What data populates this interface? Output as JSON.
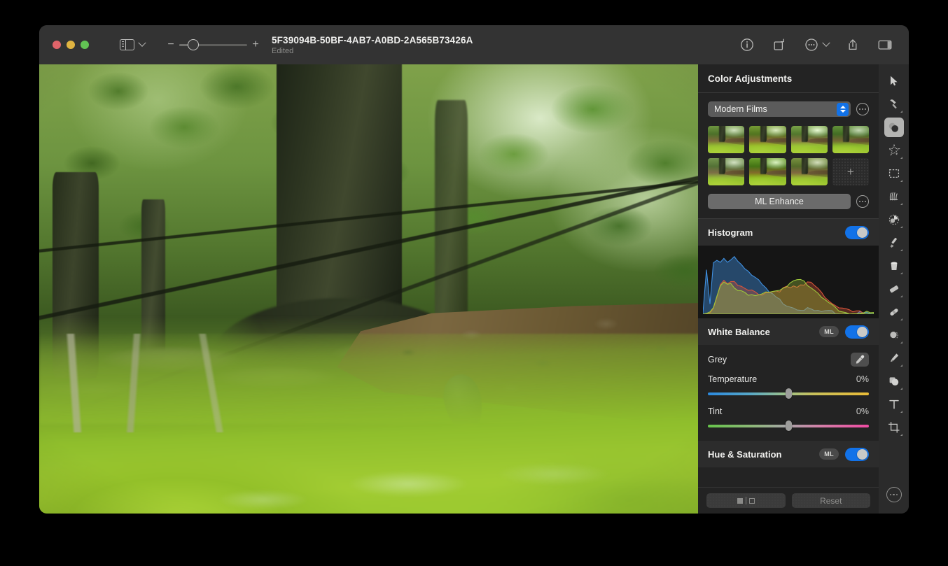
{
  "window": {
    "title": "5F39094B-50BF-4AB7-A0BD-2A565B73426A",
    "subtitle": "Edited",
    "traffic_lights": [
      "close-button",
      "minimize-button",
      "maximize-button"
    ]
  },
  "toolbar": {
    "sidebar_icon": "sidebar-icon",
    "sidebar_chevron": "chevron-down-icon",
    "zoom_out": "−",
    "zoom_in": "+",
    "zoom_value": 20,
    "right_icons": [
      "info-icon",
      "rotate-icon",
      "more-options-icon",
      "share-icon",
      "right-panel-icon"
    ]
  },
  "panel": {
    "title": "Color Adjustments",
    "presets": {
      "selected": "Modern Films",
      "options": [
        "Modern Films"
      ],
      "thumbnail_count": 7,
      "add_label": "+"
    },
    "ml_enhance": {
      "label": "ML Enhance"
    },
    "histogram": {
      "label": "Histogram",
      "enabled": true
    },
    "white_balance": {
      "label": "White Balance",
      "ml_badge": "ML",
      "enabled": true,
      "grey": {
        "label": "Grey",
        "icon": "eyedropper-icon"
      },
      "temperature": {
        "label": "Temperature",
        "value": "0%",
        "position": 50
      },
      "tint": {
        "label": "Tint",
        "value": "0%",
        "position": 50
      }
    },
    "hue_saturation": {
      "label": "Hue & Saturation",
      "ml_badge": "ML",
      "enabled": true
    },
    "footer": {
      "compare_label": "",
      "reset_label": "Reset"
    }
  },
  "tools": [
    {
      "name": "select-arrow-tool",
      "icon": "cursor-arrow-icon",
      "selected": false
    },
    {
      "name": "repair-tool",
      "icon": "hammer-icon",
      "selected": false
    },
    {
      "name": "color-adjustments-tool",
      "icon": "color-circles-icon",
      "selected": true
    },
    {
      "name": "magic-wand-tool",
      "icon": "star-sparkle-icon",
      "selected": false
    },
    {
      "name": "marquee-tool",
      "icon": "dashed-rectangle-icon",
      "selected": false
    },
    {
      "name": "retouch-tool",
      "icon": "brush-fan-icon",
      "selected": false
    },
    {
      "name": "dodge-burn-tool",
      "icon": "dodge-circle-icon",
      "selected": false
    },
    {
      "name": "paintbrush-tool",
      "icon": "paintbrush-icon",
      "selected": false
    },
    {
      "name": "paint-bucket-tool",
      "icon": "paint-bucket-icon",
      "selected": false
    },
    {
      "name": "eraser-tool",
      "icon": "eraser-icon",
      "selected": false
    },
    {
      "name": "heal-tool",
      "icon": "bandage-icon",
      "selected": false
    },
    {
      "name": "blur-tool",
      "icon": "blur-circle-icon",
      "selected": false
    },
    {
      "name": "pen-tool",
      "icon": "fountain-pen-icon",
      "selected": false
    },
    {
      "name": "shapes-tool",
      "icon": "shapes-icon",
      "selected": false
    },
    {
      "name": "text-tool",
      "icon": "text-t-icon",
      "selected": false
    },
    {
      "name": "crop-tool",
      "icon": "crop-icon",
      "selected": false
    }
  ],
  "tools_more": "more-tools-icon",
  "colors": {
    "accent_blue": "#1272e8",
    "window_bg": "#2b2b2b",
    "titlebar_bg": "#333333",
    "panel_bg": "#232323",
    "histogram_bg": "#151515",
    "close_red": "#e0646a",
    "min_yellow": "#e0b441",
    "max_green": "#62c354"
  },
  "chart_data": {
    "type": "area",
    "title": "Histogram",
    "xlabel": "",
    "ylabel": "",
    "xlim": [
      0,
      255
    ],
    "ylim": [
      0,
      100
    ],
    "grid": false,
    "legend": "none",
    "series": [
      {
        "name": "Blue",
        "color": "#3f8fdf",
        "values": [
          2,
          62,
          14,
          70,
          74,
          71,
          76,
          72,
          78,
          82,
          74,
          70,
          66,
          60,
          55,
          50,
          45,
          40,
          35,
          30,
          26,
          22,
          19,
          16,
          14,
          12,
          10,
          9,
          8,
          7,
          6,
          5,
          4,
          4,
          3,
          3,
          2,
          2,
          2,
          1,
          1,
          1,
          1,
          1,
          1,
          1,
          1,
          1,
          0,
          0
        ]
      },
      {
        "name": "Red",
        "color": "#d9543a",
        "values": [
          0,
          1,
          3,
          10,
          26,
          42,
          48,
          44,
          47,
          44,
          40,
          37,
          34,
          32,
          31,
          30,
          29,
          29,
          30,
          31,
          32,
          33,
          34,
          35,
          36,
          36,
          37,
          37,
          38,
          40,
          44,
          46,
          42,
          38,
          32,
          26,
          20,
          15,
          11,
          8,
          6,
          5,
          4,
          3,
          3,
          2,
          2,
          1,
          1,
          0
        ]
      },
      {
        "name": "Green",
        "color": "#9dc63b",
        "values": [
          0,
          1,
          2,
          8,
          22,
          38,
          43,
          40,
          41,
          38,
          35,
          33,
          31,
          29,
          28,
          27,
          27,
          27,
          28,
          29,
          30,
          31,
          33,
          36,
          40,
          44,
          48,
          51,
          50,
          47,
          43,
          38,
          33,
          28,
          23,
          18,
          14,
          11,
          8,
          6,
          5,
          4,
          3,
          2,
          2,
          1,
          1,
          1,
          0,
          0
        ]
      }
    ]
  }
}
